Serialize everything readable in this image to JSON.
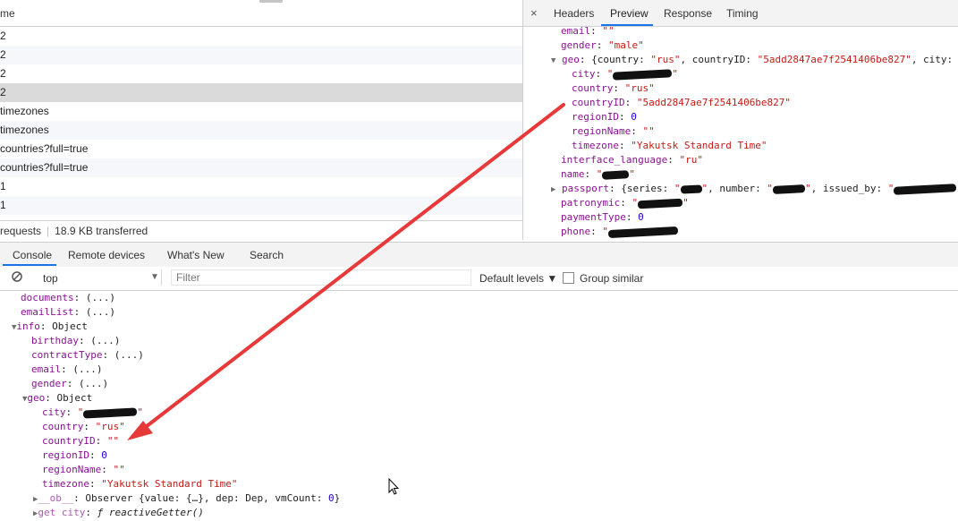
{
  "network": {
    "header": "me",
    "rows": [
      "2",
      "2",
      "2",
      "2",
      "timezones",
      "timezones",
      "countries?full=true",
      "countries?full=true",
      "1",
      "1"
    ],
    "status_requests": "requests",
    "status_transferred": "18.9 KB transferred"
  },
  "response_panel": {
    "close_label": "×",
    "tabs": [
      "Headers",
      "Preview",
      "Response",
      "Timing"
    ],
    "active_tab": "Preview",
    "lines": {
      "email_key": "email",
      "email_val": "\"\"",
      "gender_key": "gender",
      "gender_val": "\"male\"",
      "geo_key": "geo",
      "geo_summary_a": "{country: ",
      "geo_summary_b": "\"rus\"",
      "geo_summary_c": ", countryID: ",
      "geo_summary_d": "\"5add2847ae7f2541406be827\"",
      "geo_summary_e": ", city:",
      "city_key": "city",
      "city_val_a": "\"",
      "city_val_b": "\"",
      "country_key": "country",
      "country_val": "\"rus\"",
      "countryid_key": "countryID",
      "countryid_val": "\"5add2847ae7f2541406be827\"",
      "regionid_key": "regionID",
      "regionid_val": "0",
      "regionname_key": "regionName",
      "regionname_val": "\"\"",
      "timezone_key": "timezone",
      "timezone_val": "\"Yakutsk Standard Time\"",
      "iface_key": "interface_language",
      "iface_val": "\"ru\"",
      "name_key": "name",
      "name_val_a": "\"",
      "name_val_b": "\"",
      "passport_key": "passport",
      "passport_a": "{series: ",
      "passport_q": "\"",
      "passport_b": ", number: ",
      "passport_c": ", issued_by: ",
      "patronymic_key": "patronymic",
      "payment_key": "paymentType",
      "payment_val": "0",
      "phone_key": "phone"
    }
  },
  "drawer_tabs": [
    "Console",
    "Remote devices",
    "What's New",
    "Search"
  ],
  "console_toolbar": {
    "context": "top",
    "filter_placeholder": "Filter",
    "levels": "Default levels ▼",
    "group_similar": "Group similar"
  },
  "console": {
    "documents_key": "documents",
    "lazy": "(...)",
    "emaillist_key": "emailList",
    "info_key": "info",
    "object": "Object",
    "birthday_key": "birthday",
    "contract_key": "contractType",
    "email_key": "email",
    "gender_key": "gender",
    "geo_key": "geo",
    "city_key": "city",
    "quote": "\"",
    "country_key": "country",
    "country_val": "\"rus\"",
    "countryid_key": "countryID",
    "countryid_val": "\"\"",
    "regionid_key": "regionID",
    "regionid_val": "0",
    "regionname_key": "regionName",
    "regionname_val": "\"\"",
    "timezone_key": "timezone",
    "timezone_val": "\"Yakutsk Standard Time\"",
    "ob_key": "__ob__",
    "ob_val": "Observer {value: {…}, dep: Dep, vmCount: ",
    "ob_zero": "0",
    "ob_close": "}",
    "getcity_key": "get city",
    "getcity_f": "ƒ",
    "getcity_val": "reactiveGetter()"
  },
  "colors": {
    "accent": "#1a73e8",
    "property": "#881391",
    "string": "#c41a16",
    "number": "#1c00cf",
    "annotation_arrow": "#e8393a"
  }
}
